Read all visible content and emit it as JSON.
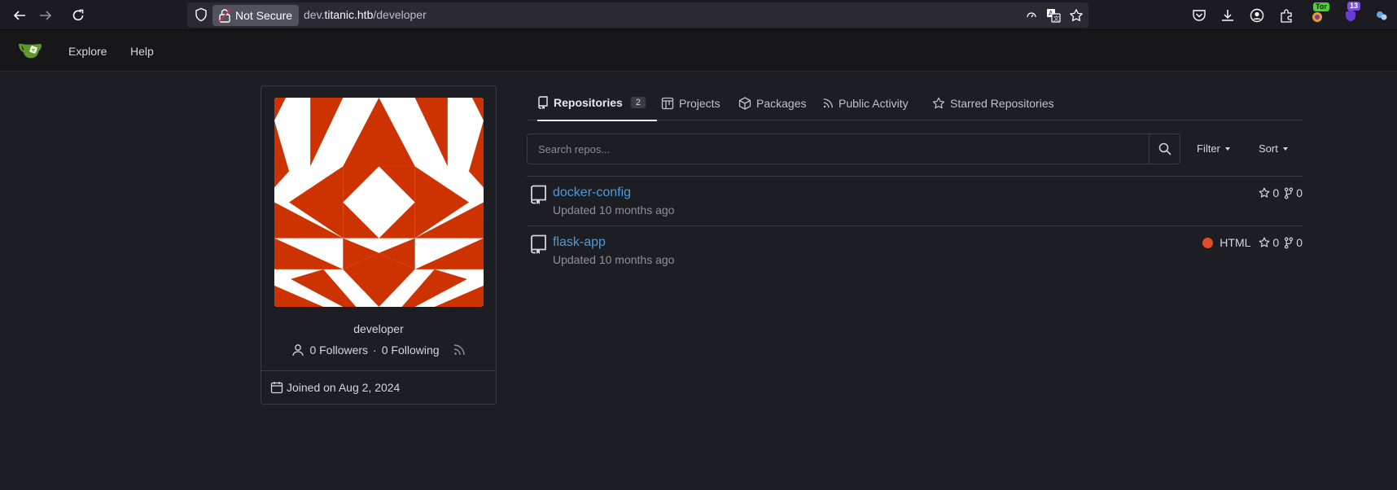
{
  "browser": {
    "url_prefix": "dev.",
    "url_domain": "titanic.htb",
    "url_path": "/developer",
    "security_label": "Not Secure",
    "tor_badge": "Tor",
    "ext_badge": "13"
  },
  "header": {
    "nav": [
      "Explore",
      "Help"
    ]
  },
  "profile": {
    "username": "developer",
    "followers": "0 Followers",
    "dot": "·",
    "following": "0 Following",
    "joined": "Joined on Aug 2, 2024"
  },
  "tabs": [
    {
      "label": "Repositories",
      "count": "2",
      "icon": "repo-icon"
    },
    {
      "label": "Projects",
      "icon": "project-icon"
    },
    {
      "label": "Packages",
      "icon": "package-icon"
    },
    {
      "label": "Public Activity",
      "icon": "rss-icon"
    },
    {
      "label": "Starred Repositories",
      "icon": "star-icon"
    }
  ],
  "search": {
    "placeholder": "Search repos...",
    "filter_label": "Filter",
    "sort_label": "Sort"
  },
  "repos": [
    {
      "name": "docker-config",
      "updated": "Updated 10 months ago",
      "language": "",
      "stars": "0",
      "forks": "0"
    },
    {
      "name": "flask-app",
      "updated": "Updated 10 months ago",
      "language": "HTML",
      "language_color": "#e34c26",
      "stars": "0",
      "forks": "0"
    }
  ],
  "colors": {
    "accent_link": "#4f9ad9",
    "avatar_red": "#cc3300",
    "gitea_green": "#609926"
  }
}
